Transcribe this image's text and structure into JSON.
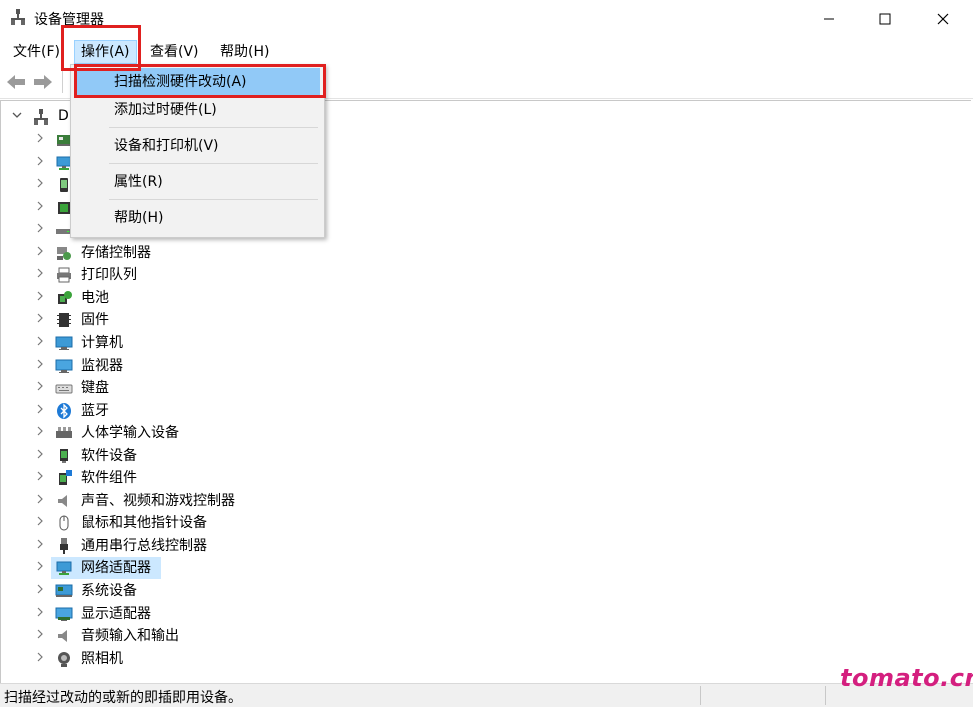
{
  "window": {
    "title": "设备管理器",
    "controls": {
      "minimize": "minimize-icon",
      "maximize": "maximize-icon",
      "close": "close-icon"
    }
  },
  "menubar": {
    "file": "文件(F)",
    "action": "操作(A)",
    "view": "查看(V)",
    "help": "帮助(H)"
  },
  "toolbar": {
    "back": "back-arrow-icon",
    "forward": "forward-arrow-icon"
  },
  "action_menu": {
    "items": [
      {
        "label": "扫描检测硬件改动(A)",
        "highlighted": true
      },
      {
        "label": "添加过时硬件(L)"
      },
      {
        "label": "设备和打印机(V)"
      },
      {
        "label": "属性(R)"
      },
      {
        "label": "帮助(H)"
      }
    ]
  },
  "tree": {
    "root_label": "DI",
    "nodes": [
      {
        "label": "",
        "icon": "network-card-icon"
      },
      {
        "label": "",
        "icon": "network-adapter-icon"
      },
      {
        "label": "",
        "icon": "mobile-device-icon"
      },
      {
        "label": "",
        "icon": "processor-icon"
      },
      {
        "label": "",
        "icon": "drive-icon"
      },
      {
        "label": "存储控制器",
        "icon": "storage-controller-icon"
      },
      {
        "label": "打印队列",
        "icon": "printer-icon"
      },
      {
        "label": "电池",
        "icon": "battery-icon"
      },
      {
        "label": "固件",
        "icon": "firmware-icon"
      },
      {
        "label": "计算机",
        "icon": "computer-icon"
      },
      {
        "label": "监视器",
        "icon": "monitor-icon"
      },
      {
        "label": "键盘",
        "icon": "keyboard-icon"
      },
      {
        "label": "蓝牙",
        "icon": "bluetooth-icon"
      },
      {
        "label": "人体学输入设备",
        "icon": "hid-icon"
      },
      {
        "label": "软件设备",
        "icon": "software-device-icon"
      },
      {
        "label": "软件组件",
        "icon": "software-component-icon"
      },
      {
        "label": "声音、视频和游戏控制器",
        "icon": "speaker-icon"
      },
      {
        "label": "鼠标和其他指针设备",
        "icon": "mouse-icon"
      },
      {
        "label": "通用串行总线控制器",
        "icon": "usb-icon"
      },
      {
        "label": "网络适配器",
        "icon": "network-adapter-icon",
        "selected": true
      },
      {
        "label": "系统设备",
        "icon": "system-device-icon"
      },
      {
        "label": "显示适配器",
        "icon": "display-adapter-icon"
      },
      {
        "label": "音频输入和输出",
        "icon": "audio-io-icon"
      },
      {
        "label": "照相机",
        "icon": "camera-icon"
      }
    ]
  },
  "statusbar": {
    "text": "扫描经过改动的或新的即插即用设备。"
  },
  "watermark": "tomato.cm",
  "colors": {
    "selection": "#cce8ff",
    "menu_highlight": "#91c9f7",
    "annotation_red": "#e0201f",
    "watermark": "#d41f7f"
  }
}
